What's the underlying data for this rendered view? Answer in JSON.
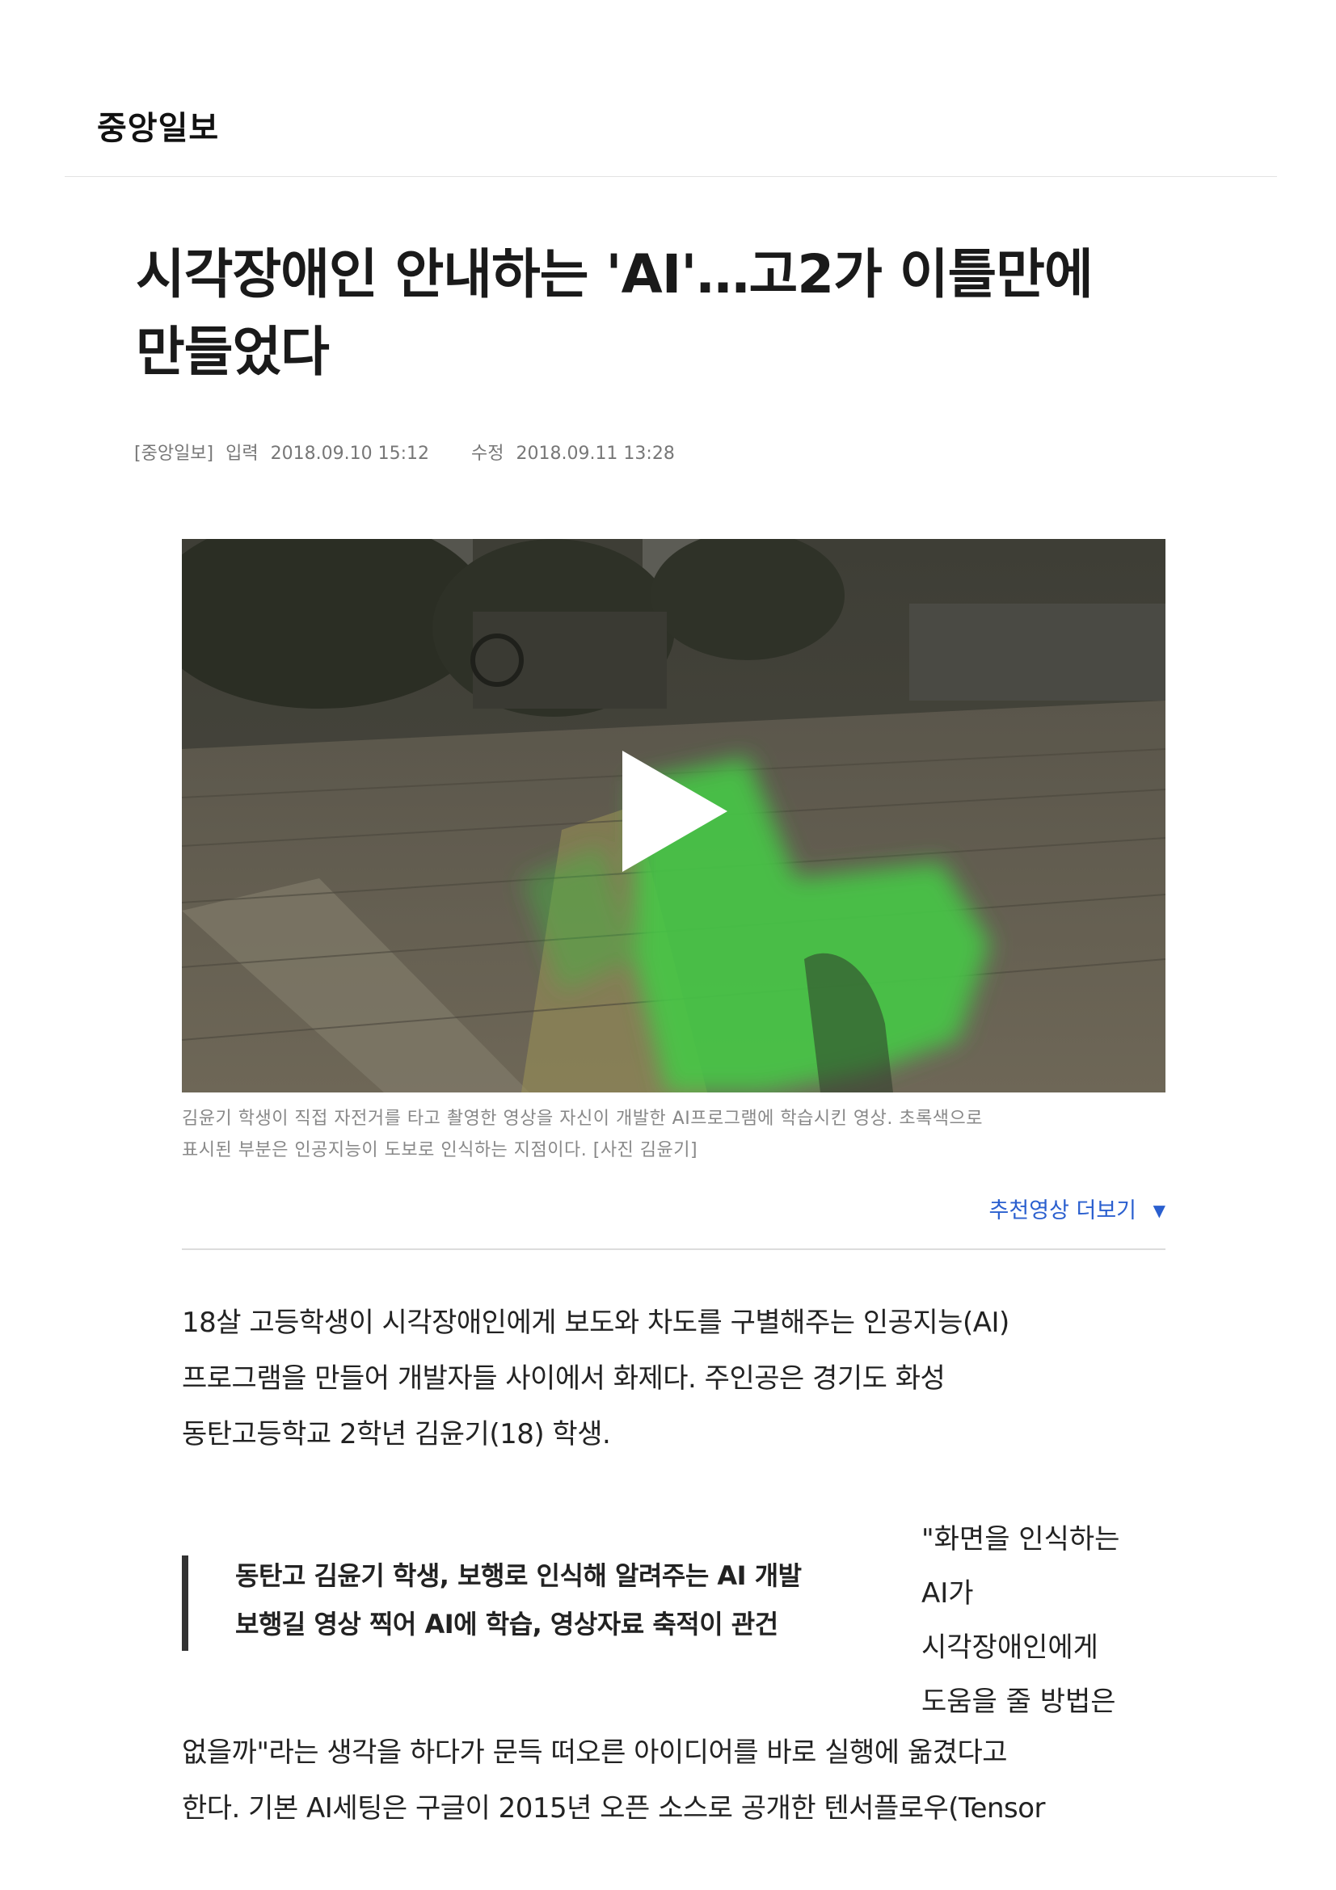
{
  "masthead": {
    "logo_text": "중앙일보"
  },
  "article": {
    "headline_line1": "시각장애인 안내하는 'AI'…고2가 이틀만에",
    "headline_line2": "만들었다",
    "meta": {
      "source": "[중앙일보]",
      "published_label": "입력",
      "published_at": "2018.09.10 15:12",
      "updated_label": "수정",
      "updated_at": "2018.09.11 13:28"
    },
    "media": {
      "play_icon": "play-icon",
      "caption_line1": "김윤기 학생이 직접 자전거를 타고 촬영한 영상을 자신이 개발한 AI프로그램에 학습시킨 영상. 초록색으로",
      "caption_line2": "표시된 부분은 인공지능이 도보로 인식하는 지점이다. [사진 김윤기]"
    },
    "more_videos": {
      "label": "추천영상 더보기",
      "icon": "triangle-down-icon"
    },
    "intro_lines": [
      "18살 고등학생이 시각장애인에게 보도와 차도를 구별해주는 인공지능(AI)",
      "프로그램을 만들어 개발자들 사이에서 화제다.  주인공은 경기도 화성",
      "동탄고등학교 2학년 김윤기(18) 학생."
    ],
    "summary_lines": [
      "동탄고 김윤기 학생, 보행로 인식해 알려주는 AI 개발",
      "보행길 영상 찍어 AI에 학습, 영상자료 축적이 관건"
    ],
    "side_lines": [
      "\"화면을 인식하는",
      "AI가",
      "시각장애인에게",
      "도움을 줄 방법은"
    ],
    "body_lines": [
      "없을까\"라는 생각을 하다가 문득 떠오른 아이디어를 바로 실행에 옮겼다고",
      "한다. 기본 AI세팅은 구글이 2015년 오픈 소스로 공개한 텐서플로우(Tensor"
    ]
  }
}
